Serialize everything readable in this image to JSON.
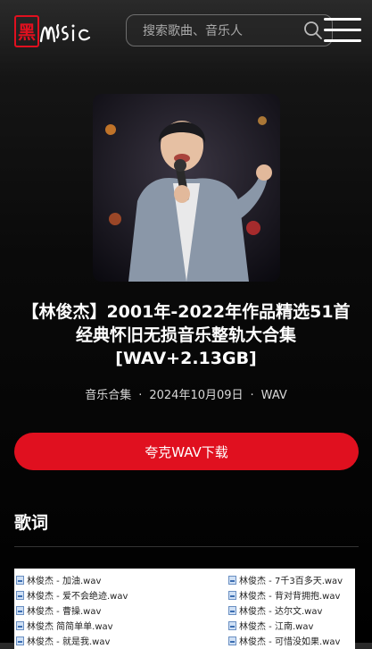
{
  "header": {
    "logo": {
      "glyph": "黑",
      "word": "MUSIC"
    },
    "search": {
      "placeholder": "搜索歌曲、音乐人"
    }
  },
  "album": {
    "title": "【林俊杰】2001年-2022年作品精选51首经典怀旧无损音乐整轨大合集[WAV+2.13GB]",
    "category": "音乐合集",
    "date": "2024年10月09日",
    "format": "WAV",
    "separator": "·"
  },
  "download_button": {
    "label": "夸克WAV下载"
  },
  "lyrics_section": {
    "title": "歌词"
  },
  "files": {
    "left": [
      "林俊杰 - 加油.wav",
      "林俊杰 - 爱不会绝迹.wav",
      "林俊杰 - 曹操.wav",
      "林俊杰  简简单单.wav",
      "林俊杰 - 就是我.wav"
    ],
    "right": [
      "林俊杰 - 7千3百多天.wav",
      "林俊杰 - 背对背拥抱.wav",
      "林俊杰 - 达尔文.wav",
      "林俊杰 - 江南.wav",
      "林俊杰 - 可惜没如果.wav"
    ]
  },
  "colors": {
    "accent": "#e0101f",
    "background": "#000000"
  }
}
